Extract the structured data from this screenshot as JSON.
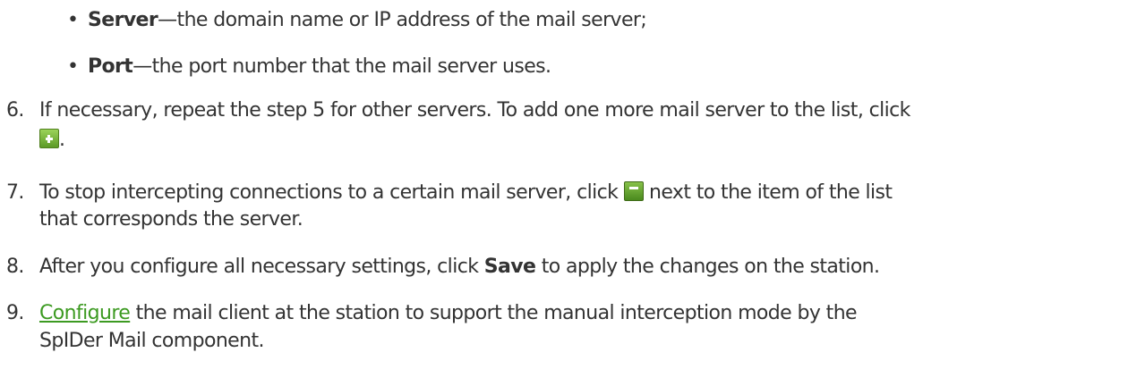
{
  "bullets": [
    {
      "term": "Server",
      "text": "—the domain name or IP address of the mail server;"
    },
    {
      "term": "Port",
      "text": "—the port number that the mail server uses."
    }
  ],
  "steps": {
    "s6": {
      "number": "6.",
      "line1": "If necessary, repeat the step 5 for other servers. To add one more mail server to the list, click",
      "after_icon": ".",
      "icon": "add-plus-icon"
    },
    "s7": {
      "number": "7.",
      "before_icon": "To stop intercepting connections to a certain mail server, click ",
      "after_icon": " next to the item of the list",
      "line2": "that corresponds the server.",
      "icon": "remove-minus-icon"
    },
    "s8": {
      "number": "8.",
      "before_bold": "After you configure all necessary settings, click ",
      "bold": "Save",
      "after_bold": " to apply the changes on the station."
    },
    "s9": {
      "number": "9.",
      "link": "Configure",
      "after_link": " the mail client at the station to support the manual interception mode by the",
      "line2": "SpIDer Mail component."
    }
  },
  "colors": {
    "text": "#333333",
    "link": "#3c9a21",
    "icon_green": "#5c9a26"
  }
}
